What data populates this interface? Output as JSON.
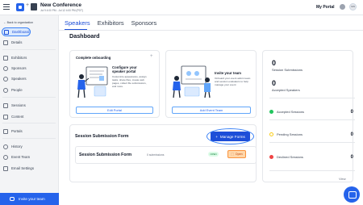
{
  "header": {
    "title": "New Conference",
    "date": "Jul 9 4:00 PM - Jul 12 4:00 PM (PDT)",
    "my_portal": "My Portal",
    "user_initials": "GN"
  },
  "sidebar": {
    "back": "Back to organization",
    "items": [
      {
        "label": "Dashboard",
        "icon": "dashboard-icon"
      },
      {
        "label": "Details",
        "icon": "details-icon"
      },
      {
        "label": "Exhibitors",
        "icon": "exhibitors-icon"
      },
      {
        "label": "Sponsors",
        "icon": "sponsors-icon"
      },
      {
        "label": "Speakers",
        "icon": "speakers-icon"
      },
      {
        "label": "People",
        "icon": "people-icon"
      },
      {
        "label": "Sessions",
        "icon": "sessions-icon"
      },
      {
        "label": "Content",
        "icon": "content-icon"
      },
      {
        "label": "Portals",
        "icon": "portals-icon"
      },
      {
        "label": "History",
        "icon": "history-icon"
      },
      {
        "label": "Event Team",
        "icon": "event-team-icon"
      },
      {
        "label": "Email Settings",
        "icon": "email-icon"
      }
    ],
    "invite": "Invite your team"
  },
  "tabs": [
    "Speakers",
    "Exhibitors",
    "Sponsors"
  ],
  "page_title": "Dashboard",
  "onboarding": {
    "heading": "Complete onboarding",
    "title": "Configure your speaker portal",
    "desc": "Customize appearance, assign tasks, share files, create web pages, collect file submissions, and more.",
    "button": "Edit Portal"
  },
  "invite_card": {
    "title": "Invite your team",
    "desc": "Onboard your event admin team and session evaluators to help manage your event",
    "button": "Add Event Team"
  },
  "stats": {
    "submissions_value": "0",
    "submissions_label": "Session Submissions",
    "accepted_speakers_value": "0",
    "accepted_speakers_label": "Accepted Speakers",
    "rows": [
      {
        "label": "Accepted Sessions",
        "value": "0",
        "color": "#22c55e"
      },
      {
        "label": "Pending Sessions",
        "value": "0",
        "color": "#facc15"
      },
      {
        "label": "Declined Sessions",
        "value": "0",
        "color": "#ef4444"
      }
    ],
    "view": "View"
  },
  "submission_form": {
    "title": "Session Submission Form",
    "manage_button": "Manage Forms",
    "form_name": "Session Submission Form",
    "submissions": "0 submissions",
    "status": "OPEN",
    "open_button": "Open"
  }
}
